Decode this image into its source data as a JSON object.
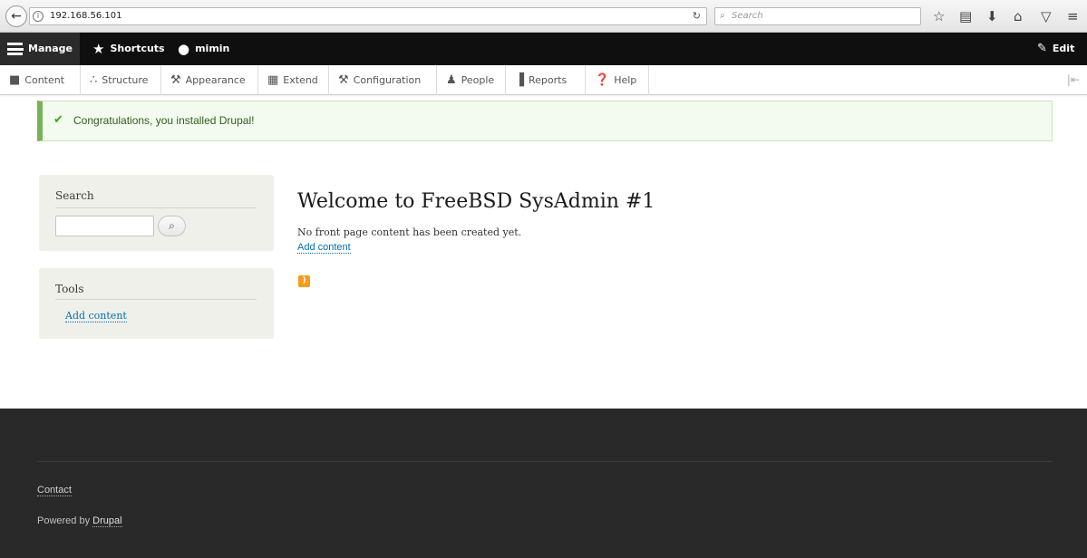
{
  "browser": {
    "url": "192.168.56.101",
    "search_placeholder": "Search",
    "icons": [
      "back-icon",
      "info-icon",
      "reload-icon",
      "bookmark-star-icon",
      "reading-list-icon",
      "download-icon",
      "home-icon",
      "pocket-icon",
      "menu-icon"
    ]
  },
  "toolbar": {
    "manage": "Manage",
    "shortcuts": "Shortcuts",
    "user": "mimin",
    "edit": "Edit"
  },
  "tray": {
    "items": [
      {
        "label": "Content",
        "icon": "content-icon"
      },
      {
        "label": "Structure",
        "icon": "structure-icon"
      },
      {
        "label": "Appearance",
        "icon": "appearance-icon"
      },
      {
        "label": "Extend",
        "icon": "extend-icon"
      },
      {
        "label": "Configuration",
        "icon": "configuration-icon"
      },
      {
        "label": "People",
        "icon": "people-icon"
      },
      {
        "label": "Reports",
        "icon": "reports-icon"
      },
      {
        "label": "Help",
        "icon": "help-icon"
      }
    ]
  },
  "status": {
    "message": "Congratulations, you installed Drupal!"
  },
  "sidebar": {
    "search_title": "Search",
    "tools_title": "Tools",
    "tools_link": "Add content"
  },
  "main": {
    "title": "Welcome to FreeBSD SysAdmin #1",
    "empty_text": "No front page content has been created yet.",
    "add_link": "Add content"
  },
  "footer": {
    "contact": "Contact",
    "powered_prefix": "Powered by ",
    "powered_link": "Drupal"
  },
  "colors": {
    "toolbar_bg": "#0f0f0f",
    "status_accent": "#77b259",
    "link": "#0071b3",
    "footer_bg": "#292929",
    "feed": "#f89c1c"
  }
}
